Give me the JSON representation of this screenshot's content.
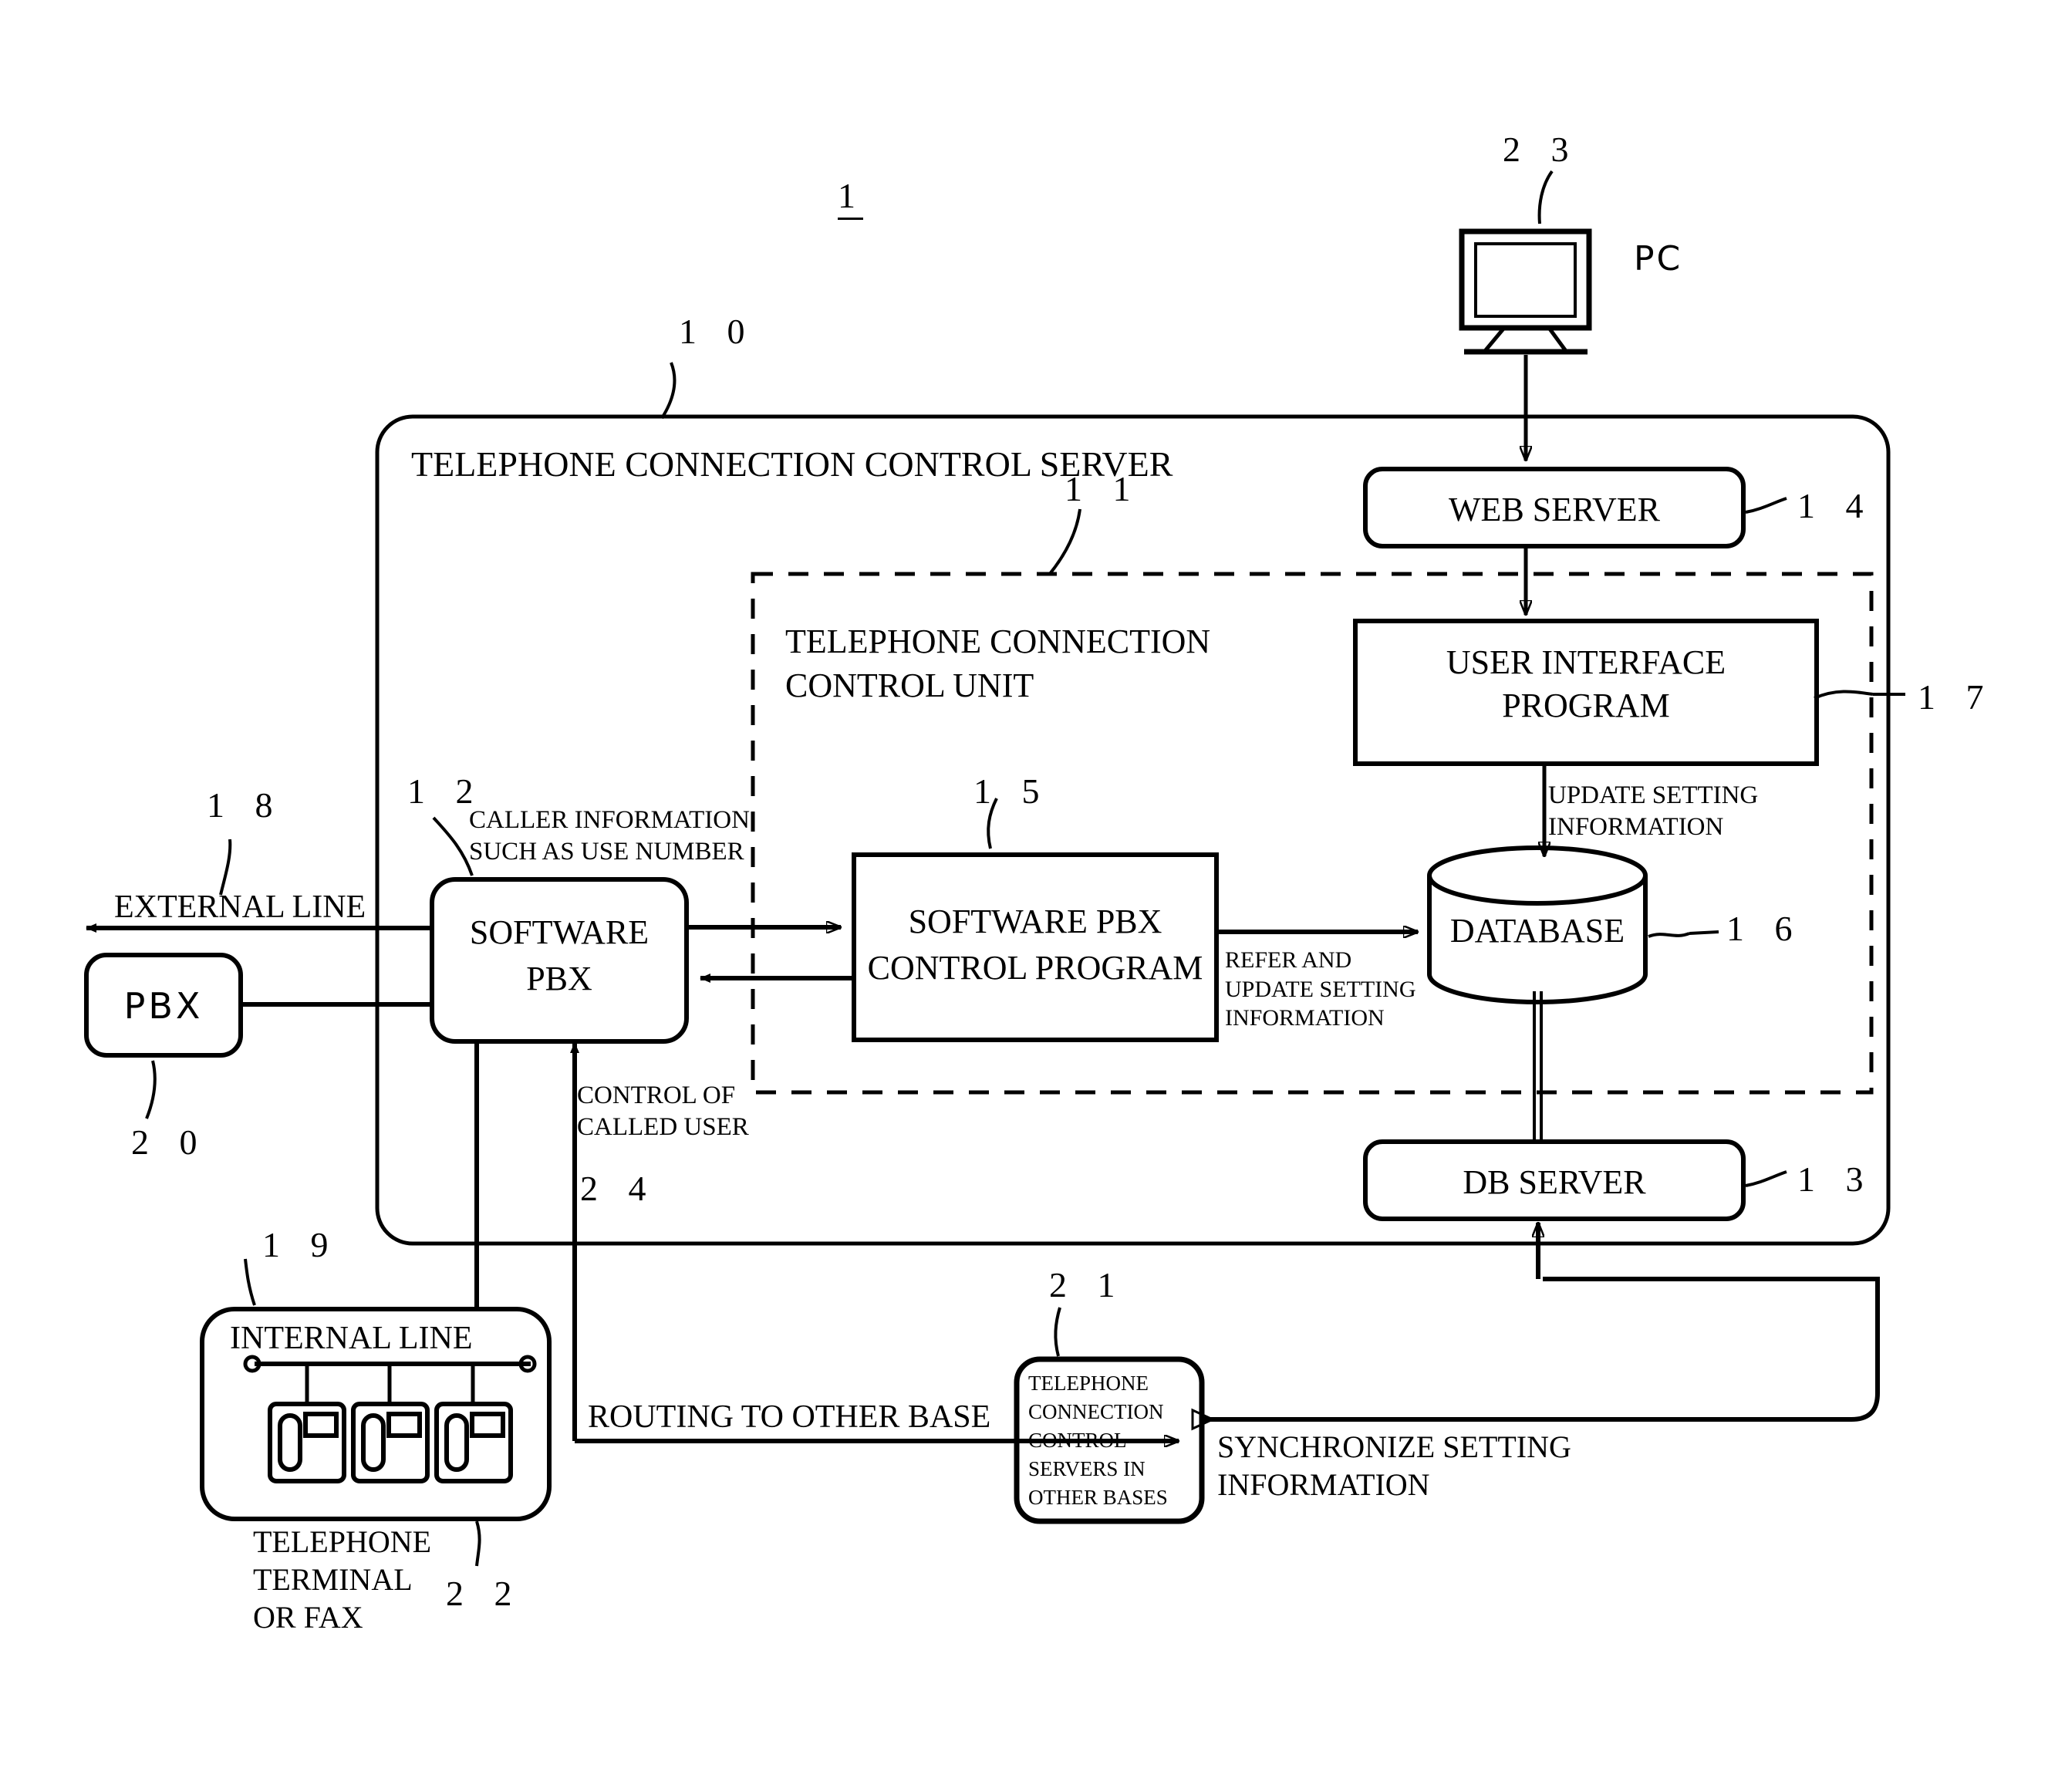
{
  "figure": {
    "number": "1",
    "type": "patent-block-diagram",
    "title": "Telephone connection control server system block diagram"
  },
  "reference_numerals": {
    "figure": "1",
    "server": "1 0",
    "control_unit": "1 1",
    "software_pbx": "1 2",
    "db_server": "1 3",
    "web_server": "1 4",
    "pbx_control_program": "1 5",
    "database": "1 6",
    "ui_program": "1 7",
    "external_line": "1 8",
    "internal_line": "1 9",
    "pbx": "2 0",
    "other_bases": "2 1",
    "telephone_terminal": "2 2",
    "pc": "2 3",
    "control_called_user": "2 4"
  },
  "nodes": {
    "server": {
      "label": "TELEPHONE CONNECTION CONTROL SERVER"
    },
    "control_unit": {
      "line1": "TELEPHONE CONNECTION",
      "line2": "CONTROL UNIT"
    },
    "web_server": {
      "label": "WEB SERVER"
    },
    "ui_program": {
      "line1": "USER INTERFACE",
      "line2": "PROGRAM"
    },
    "database": {
      "label": "DATABASE"
    },
    "db_server": {
      "label": "DB SERVER"
    },
    "software_pbx": {
      "line1": "SOFTWARE",
      "line2": "PBX"
    },
    "pbx_control_program": {
      "line1": "SOFTWARE PBX",
      "line2": "CONTROL PROGRAM"
    },
    "pbx": {
      "label": "PBX"
    },
    "pc": {
      "label": "PC"
    },
    "internal_line": {
      "label": "INTERNAL LINE"
    },
    "other_bases": {
      "line1": "TELEPHONE",
      "line2": "CONNECTION",
      "line3": "CONTROL",
      "line4": "SERVERS IN",
      "line5": "OTHER BASES"
    }
  },
  "edge_labels": {
    "external_line": "EXTERNAL LINE",
    "caller_information": "CALLER INFORMATION\nSUCH AS USE NUMBER",
    "control_of_called_user": "CONTROL OF\nCALLED USER",
    "update_setting_information": "UPDATE SETTING\nINFORMATION",
    "refer_and_update_setting_information": "REFER AND\nUPDATE SETTING\nINFORMATION",
    "routing_to_other_base": "ROUTING TO OTHER BASE",
    "synchronize_setting_information": "SYNCHRONIZE SETTING\nINFORMATION",
    "telephone_terminal_or_fax": "TELEPHONE\nTERMINAL\nOR FAX"
  },
  "colors": {
    "stroke": "#000000",
    "background": "#ffffff"
  }
}
